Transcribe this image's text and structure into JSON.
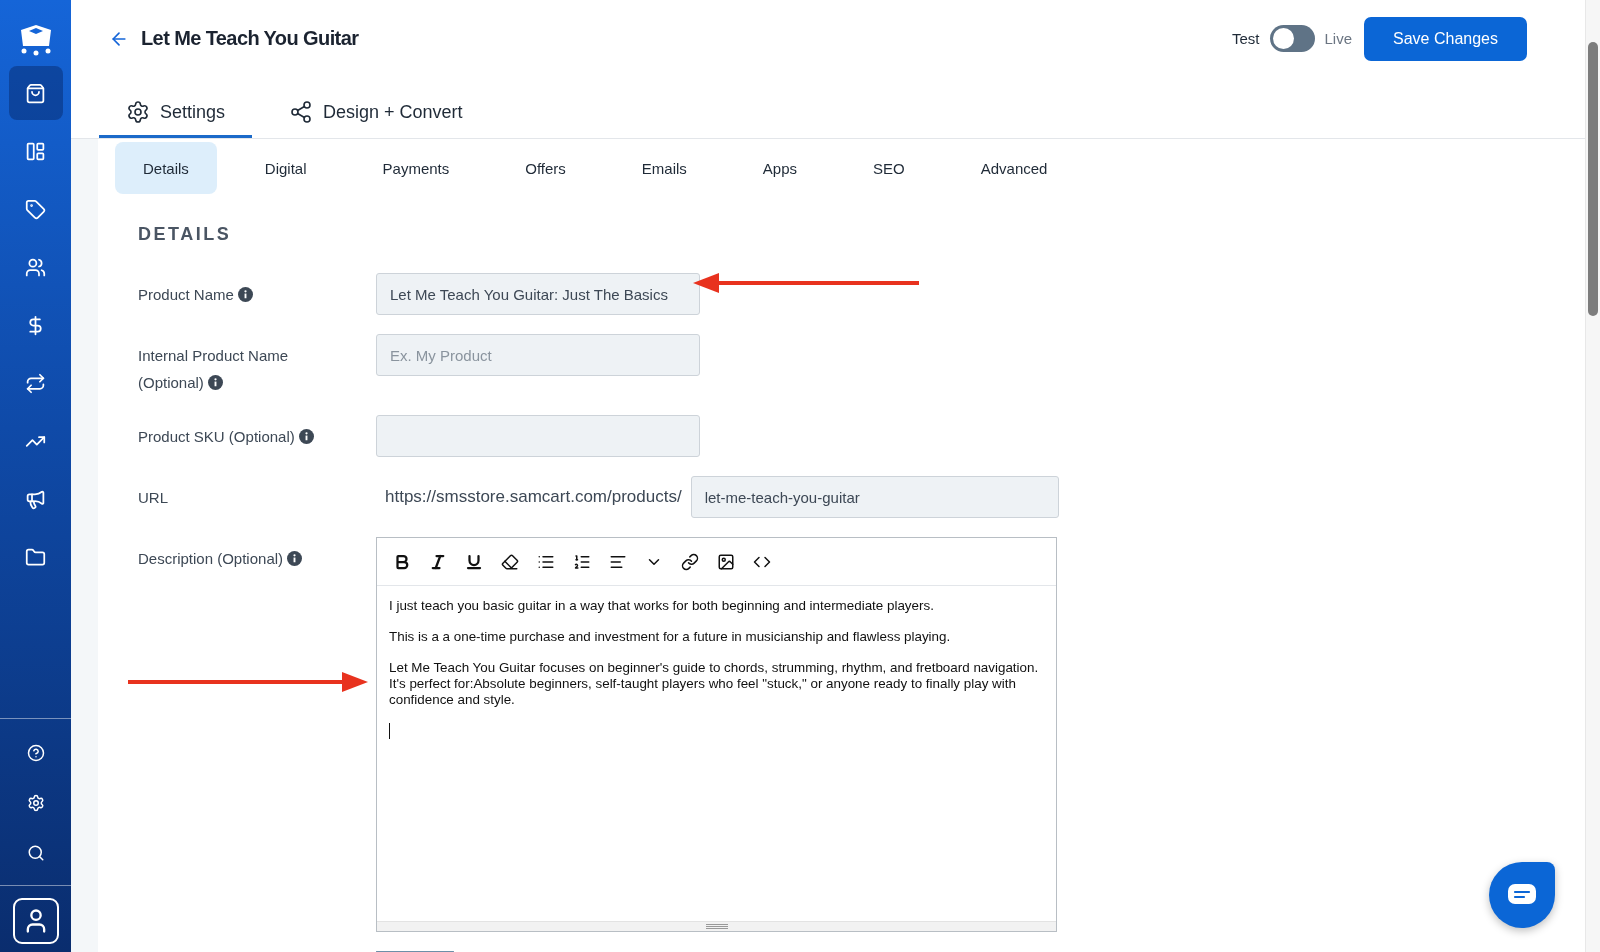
{
  "sidebar": {
    "items": [
      {
        "selected": true
      },
      {
        "selected": false
      },
      {
        "selected": false
      },
      {
        "selected": false
      },
      {
        "selected": false
      },
      {
        "selected": false
      },
      {
        "selected": false
      },
      {
        "selected": false
      },
      {
        "selected": false
      }
    ]
  },
  "header": {
    "title": "Let Me Teach You Guitar",
    "mode": {
      "off_label": "Test",
      "on_label": "Live",
      "on": false
    },
    "save_button": "Save Changes"
  },
  "main_tabs": [
    {
      "label": "Settings",
      "selected": true
    },
    {
      "label": "Design + Convert",
      "selected": false
    }
  ],
  "sub_tabs": [
    {
      "label": "Details",
      "selected": true
    },
    {
      "label": "Digital",
      "selected": false
    },
    {
      "label": "Payments",
      "selected": false
    },
    {
      "label": "Offers",
      "selected": false
    },
    {
      "label": "Emails",
      "selected": false
    },
    {
      "label": "Apps",
      "selected": false
    },
    {
      "label": "SEO",
      "selected": false
    },
    {
      "label": "Advanced",
      "selected": false
    }
  ],
  "section_title": "DETAILS",
  "fields": [
    {
      "kind": "input",
      "label": "Product Name",
      "info": true,
      "value": "Let Me Teach You Guitar: Just The Basics"
    },
    {
      "kind": "input",
      "label": "Internal Product Name (Optional)",
      "info": true,
      "placeholder": "Ex. My Product"
    },
    {
      "kind": "input",
      "label": "Product SKU (Optional)",
      "info": true
    },
    {
      "kind": "url",
      "label": "URL",
      "info": false,
      "prefix": "https://smsstore.samcart.com/products/",
      "value": "let-me-teach-you-guitar"
    },
    {
      "kind": "editor",
      "label": "Description (Optional)",
      "info": true,
      "paragraphs": [
        "I just teach you basic guitar in a way that works for both beginning and intermediate players.",
        "This is a a one-time purchase and investment for a future in musicianship and flawless playing.",
        "Let Me Teach You Guitar focuses on beginner's guide to chords, strumming, rhythm, and fretboard navigation. It's perfect for:Absolute beginners, self-taught players who feel \"stuck,\" or anyone ready to finally play with confidence and style."
      ]
    }
  ]
}
